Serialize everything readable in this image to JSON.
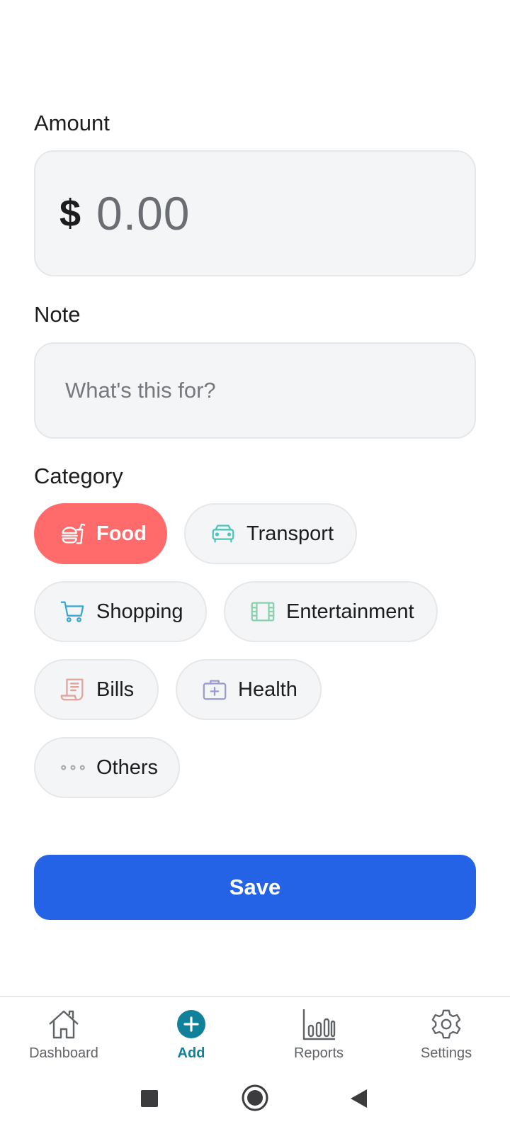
{
  "form": {
    "amount_label": "Amount",
    "currency_symbol": "$",
    "amount_placeholder": "0.00",
    "note_label": "Note",
    "note_placeholder": "What's this for?",
    "category_label": "Category",
    "save_label": "Save"
  },
  "categories": [
    {
      "label": "Food",
      "icon": "food-icon",
      "selected": true,
      "color": "#ff6b6b"
    },
    {
      "label": "Transport",
      "icon": "car-icon",
      "selected": false,
      "color": "#4ec3b7"
    },
    {
      "label": "Shopping",
      "icon": "cart-icon",
      "selected": false,
      "color": "#3aa7d6"
    },
    {
      "label": "Entertainment",
      "icon": "film-icon",
      "selected": false,
      "color": "#8cd0ad"
    },
    {
      "label": "Bills",
      "icon": "receipt-icon",
      "selected": false,
      "color": "#e0a49c"
    },
    {
      "label": "Health",
      "icon": "medical-kit-icon",
      "selected": false,
      "color": "#9c9bd0"
    },
    {
      "label": "Others",
      "icon": "more-dots-icon",
      "selected": false,
      "color": "#a8a8ab"
    }
  ],
  "nav": [
    {
      "label": "Dashboard",
      "icon": "home-icon",
      "active": false
    },
    {
      "label": "Add",
      "icon": "add-circle-icon",
      "active": true
    },
    {
      "label": "Reports",
      "icon": "bar-chart-icon",
      "active": false
    },
    {
      "label": "Settings",
      "icon": "gear-icon",
      "active": false
    }
  ],
  "colors": {
    "primary": "#2563e6",
    "accent": "#10809b",
    "food_selected": "#ff6b6b"
  }
}
